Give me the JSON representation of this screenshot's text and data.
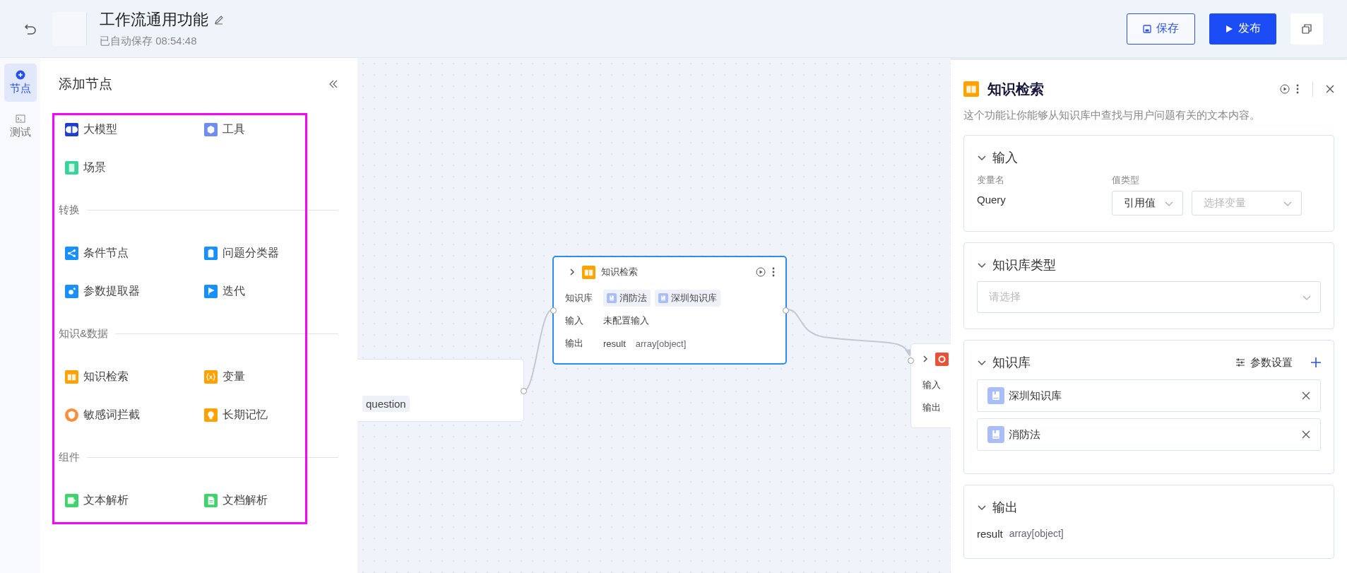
{
  "header": {
    "title": "工作流通用功能",
    "autosave": "已自动保存 08:54:48",
    "buttons": [
      {
        "label": "保存",
        "kind": "outline"
      },
      {
        "label": "发布",
        "kind": "primary"
      }
    ]
  },
  "rail": [
    {
      "label": "节点",
      "selected": true
    },
    {
      "label": "测试",
      "selected": false
    }
  ],
  "node_panel": {
    "title": "添加节点",
    "groups": [
      {
        "items": [
          "大模型",
          "工具",
          "场景"
        ]
      },
      {
        "heading": "转换",
        "items": [
          "条件节点",
          "问题分类器",
          "参数提取器",
          "迭代"
        ]
      },
      {
        "heading": "知识&数据",
        "items": [
          "知识检索",
          "变量",
          "敏感词拦截",
          "长期记忆"
        ]
      },
      {
        "heading": "组件",
        "items": [
          "文本解析",
          "文档解析"
        ]
      }
    ]
  },
  "canvas": {
    "nodes": [
      {
        "kind": "partial_left",
        "selected": false,
        "chip": "question"
      },
      {
        "kind": "full",
        "selected": true,
        "title": "知识检索",
        "rows": [
          {
            "label": "知识库",
            "chips": [
              "消防法",
              "深圳知识库"
            ]
          },
          {
            "label": "输入",
            "value": "未配置输入"
          },
          {
            "label": "输出",
            "value": "result",
            "type": "array[object]"
          }
        ]
      },
      {
        "kind": "partial_right",
        "selected": false,
        "rows": [
          "输入",
          "输出"
        ]
      }
    ]
  },
  "inspector": {
    "title": "知识检索",
    "description": "这个功能让你能够从知识库中查找与用户问题有关的文本内容。",
    "sections": [
      {
        "kind": "input",
        "heading": "输入",
        "expanded": true,
        "columns": [
          "变量名",
          "值类型"
        ],
        "var_name": "Query",
        "value_type": "引用值",
        "variable_placeholder": "选择变量"
      },
      {
        "kind": "select",
        "heading": "知识库类型",
        "expanded": true,
        "placeholder": "请选择"
      },
      {
        "kind": "list",
        "heading": "知识库",
        "expanded": true,
        "settings": "参数设置",
        "items": [
          "深圳知识库",
          "消防法"
        ]
      },
      {
        "kind": "output",
        "heading": "输出",
        "expanded": true,
        "name": "result",
        "type": "array[object]"
      }
    ]
  }
}
